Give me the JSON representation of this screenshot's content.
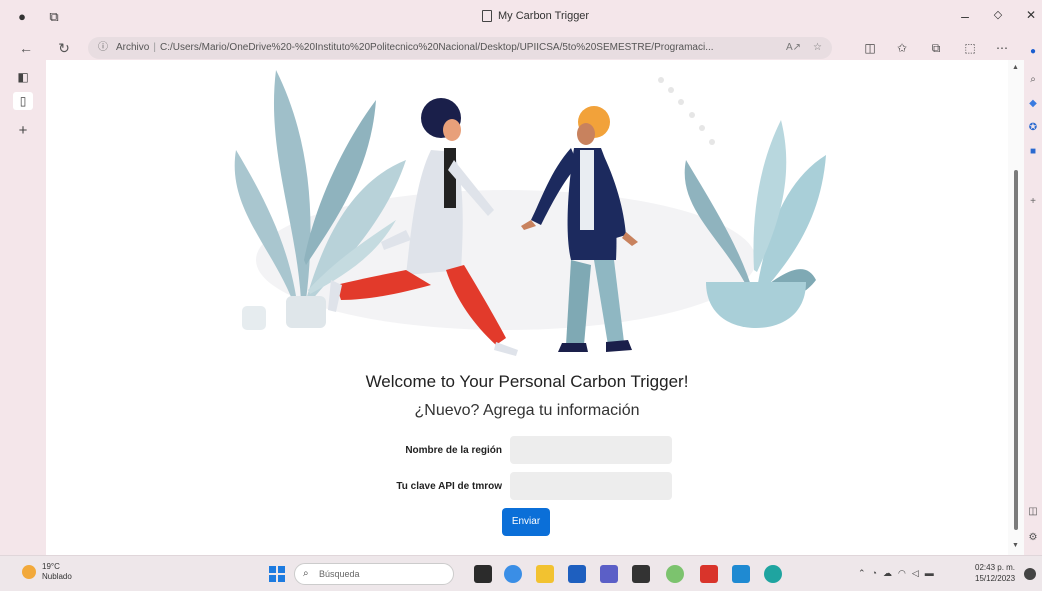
{
  "browser": {
    "tab_title": "My Carbon Trigger",
    "address_prefix": "Archivo",
    "address_url": "C:/Users/Mario/OneDrive%20-%20Instituto%20Politecnico%20Nacional/Desktop/UPIICSA/5to%20SEMESTRE/Programaci...",
    "win_minimize": "–",
    "win_maximize": "◇",
    "win_close": "✕"
  },
  "page": {
    "welcome": "Welcome to Your Personal Carbon Trigger!",
    "subtitle": "¿Nuevo? Agrega tu información",
    "form": {
      "region_label": "Nombre de la región",
      "region_value": "",
      "api_label": "Tu clave API de tmrow",
      "api_value": "",
      "submit_label": "Enviar"
    }
  },
  "taskbar": {
    "weather_temp": "19°C",
    "weather_desc": "Nublado",
    "search_placeholder": "Búsqueda",
    "time": "02:43 p. m.",
    "date": "15/12/2023"
  },
  "colors": {
    "accent": "#0b6fd8",
    "browser_frame": "#f4e6ea",
    "plant_teal": "#a9cfd8",
    "plant_dark": "#7fa9b4",
    "figure_red": "#e23a2b",
    "figure_navy": "#1c2a5e",
    "figure_orange": "#f2a23a"
  }
}
